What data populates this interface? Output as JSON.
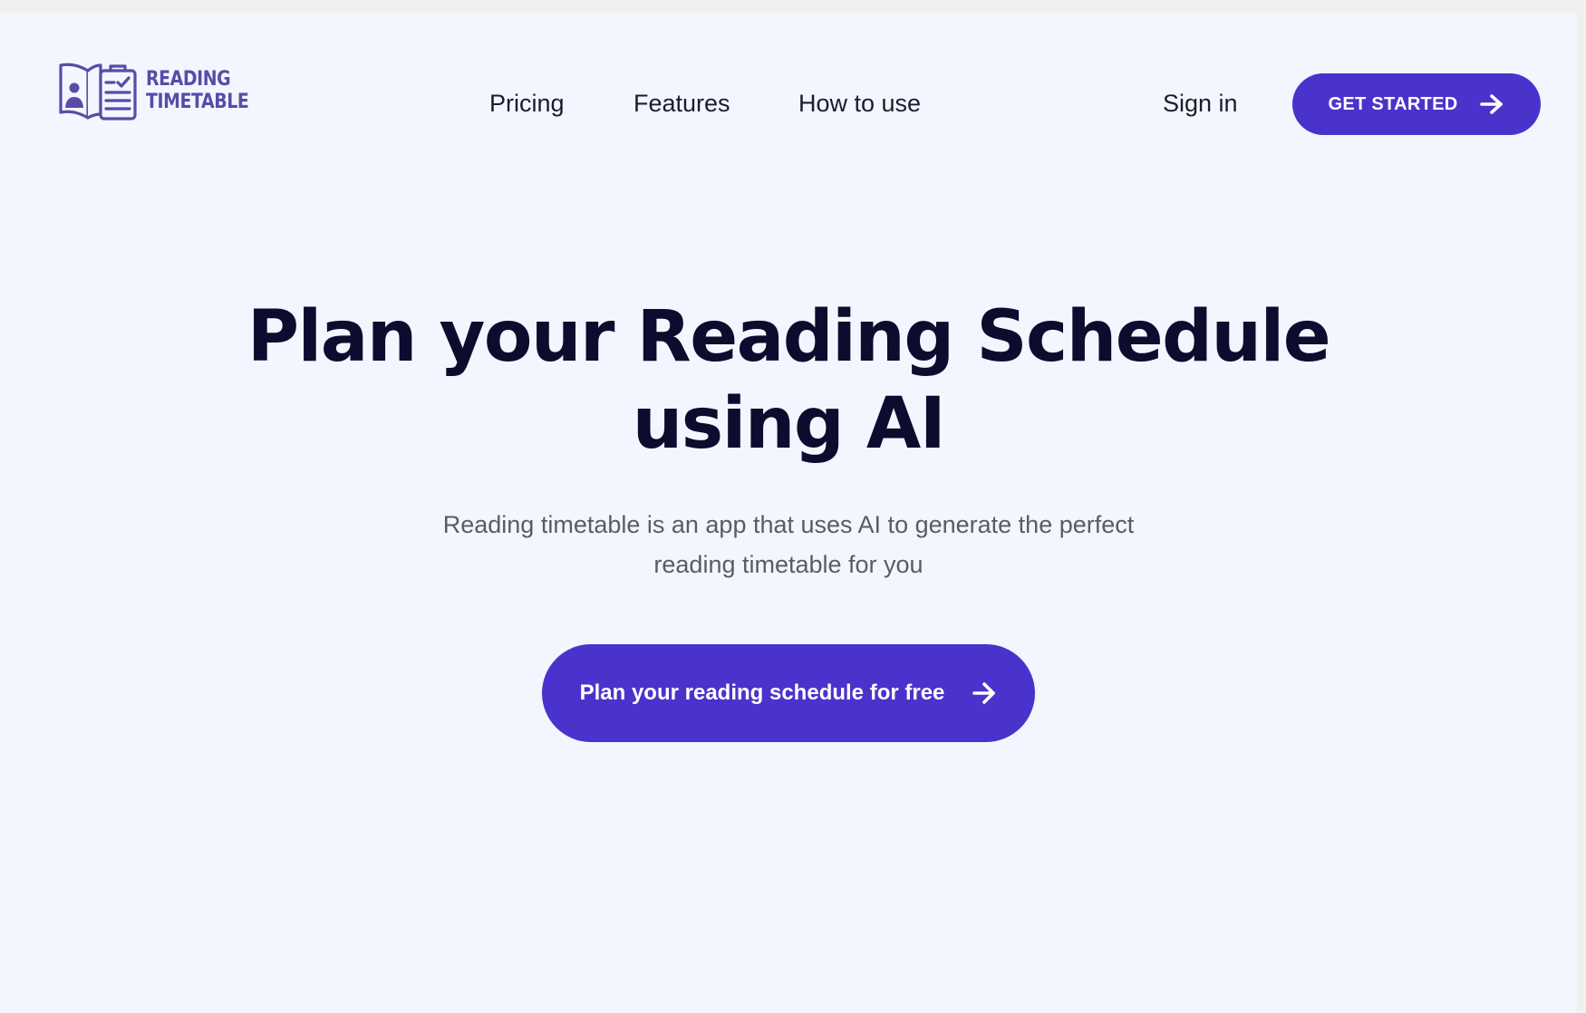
{
  "header": {
    "logo": {
      "line1": "READING",
      "line2": "TIMETABLE",
      "icon": "book-checklist-icon"
    },
    "nav": {
      "pricing": "Pricing",
      "features": "Features",
      "how_to_use": "How to use",
      "sign_in": "Sign in"
    },
    "cta_label": "GET STARTED",
    "cta_icon": "arrow-right-icon"
  },
  "hero": {
    "title_line1": "Plan your Reading Schedule",
    "title_line2": "using AI",
    "subtitle": "Reading timetable is an app that uses AI to generate the  perfect\nreading timetable for you",
    "cta_label": "Plan your reading schedule for free",
    "cta_icon": "arrow-right-icon"
  },
  "colors": {
    "background": "#f3f6fe",
    "accent": "#4a33cc",
    "logo": "#5a4ba8",
    "heading": "#0d0b2e",
    "body_text": "#5b5b66"
  }
}
